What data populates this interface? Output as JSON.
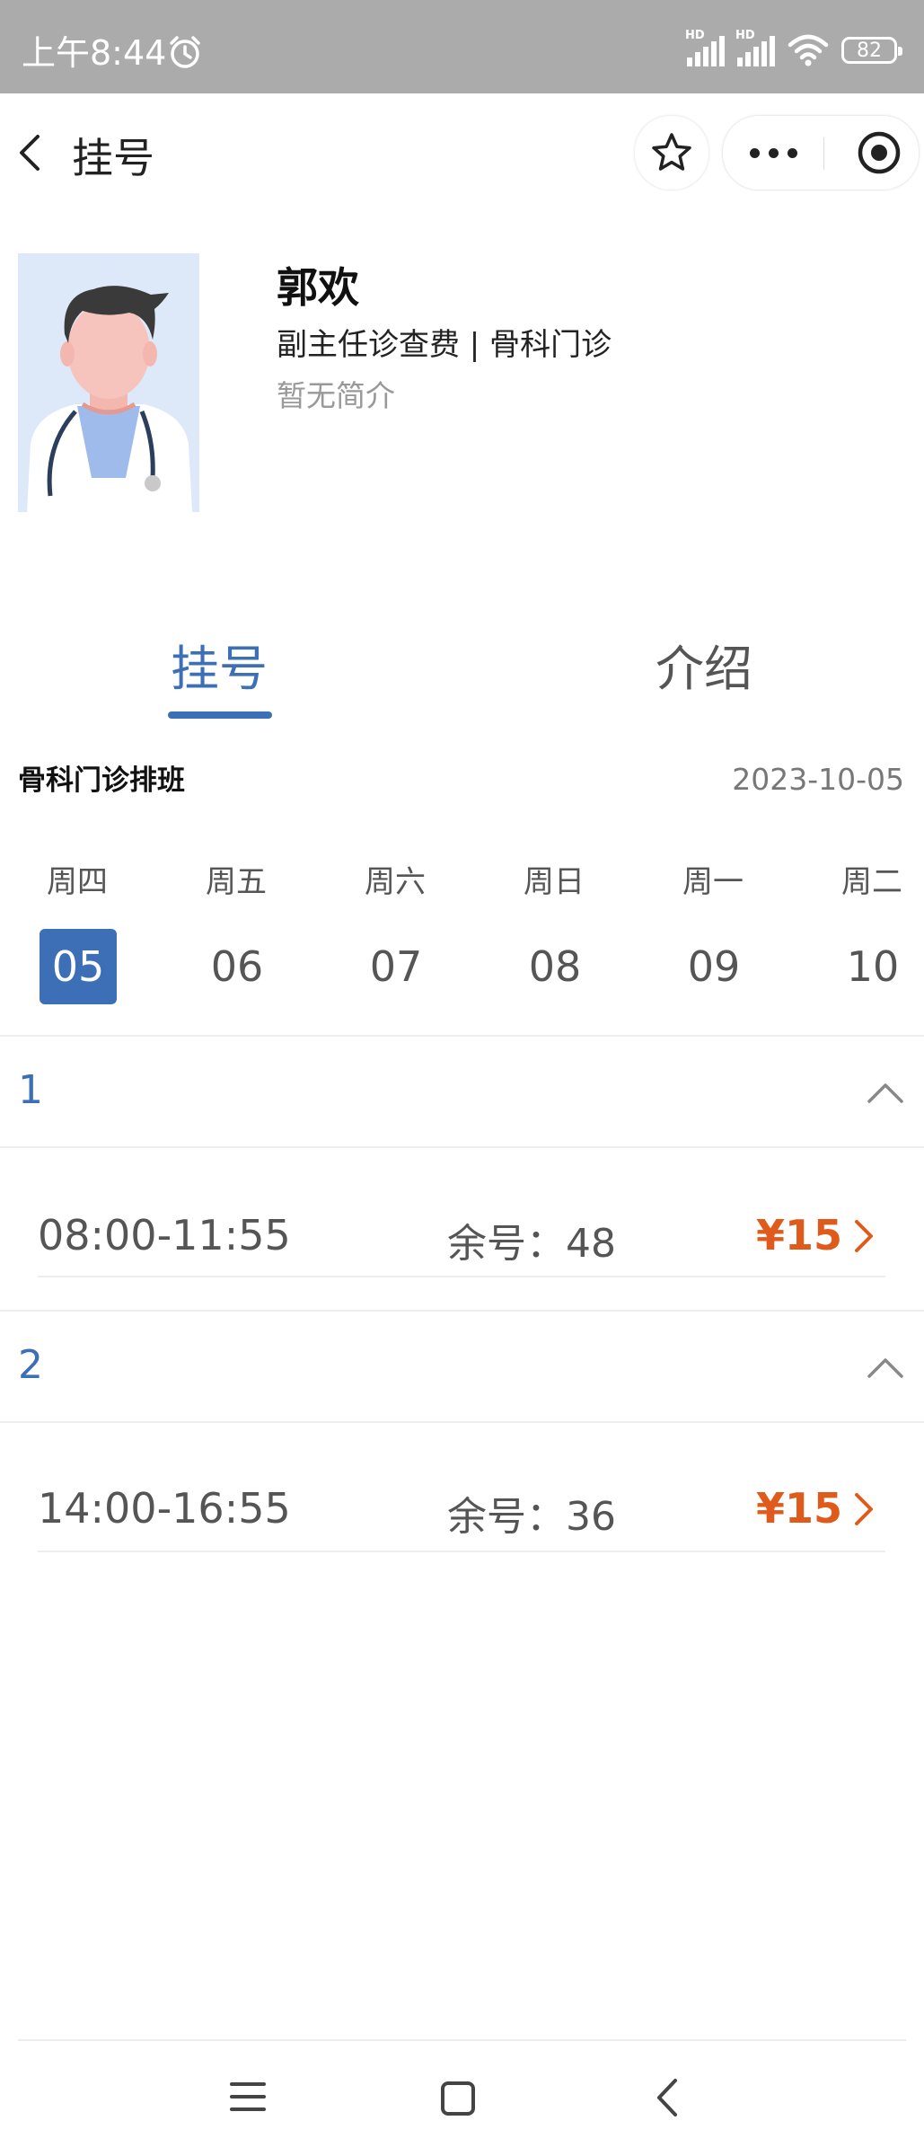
{
  "status_bar": {
    "time": "上午8:44",
    "signal1_label": "HD",
    "signal2_label": "HD",
    "battery": "82",
    "icons": [
      "alarm-icon",
      "signal-icon",
      "signal-icon",
      "wifi-icon",
      "battery-icon"
    ]
  },
  "nav": {
    "title": "挂号",
    "icons": [
      "back-arrow-icon",
      "star-icon",
      "more-dots-icon",
      "target-close-icon"
    ]
  },
  "doctor": {
    "name": "郭欢",
    "title_line": "副主任诊查费 | 骨科门诊",
    "intro": "暂无简介"
  },
  "tabs": [
    {
      "label": "挂号",
      "active": true
    },
    {
      "label": "介绍",
      "active": false
    }
  ],
  "schedule": {
    "title": "骨科门诊排班",
    "date": "2023-10-05",
    "days": [
      {
        "weekday": "周四",
        "day": "05",
        "selected": true
      },
      {
        "weekday": "周五",
        "day": "06",
        "selected": false
      },
      {
        "weekday": "周六",
        "day": "07",
        "selected": false
      },
      {
        "weekday": "周日",
        "day": "08",
        "selected": false
      },
      {
        "weekday": "周一",
        "day": "09",
        "selected": false
      },
      {
        "weekday": "周二",
        "day": "10",
        "selected": false
      }
    ]
  },
  "sections": [
    {
      "number": "1",
      "slot": {
        "time": "08:00-11:55",
        "remaining": "余号：48",
        "price": "¥15"
      }
    },
    {
      "number": "2",
      "slot": {
        "time": "14:00-16:55",
        "remaining": "余号：36",
        "price": "¥15"
      }
    }
  ],
  "colors": {
    "accent": "#3c6fb6",
    "price": "#e05a1c",
    "status_bar": "#ababab"
  },
  "system_nav": {
    "icons": [
      "menu-icon",
      "home-square-icon",
      "back-chevron-icon"
    ]
  }
}
